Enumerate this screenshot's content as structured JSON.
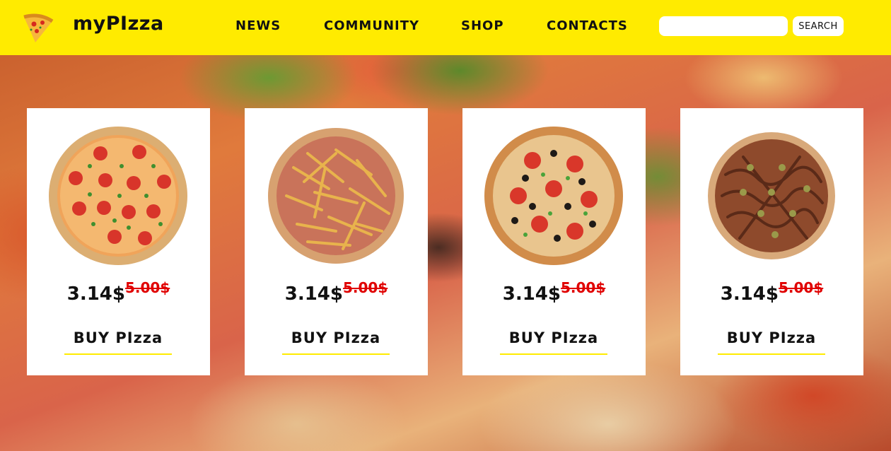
{
  "header": {
    "brand": "myPIzza",
    "nav": [
      {
        "label": "NEWS"
      },
      {
        "label": "COMMUNITY"
      },
      {
        "label": "SHOP"
      },
      {
        "label": "CONTACTS"
      }
    ],
    "search": {
      "value": "",
      "placeholder": "",
      "button_label": "SEARCH"
    }
  },
  "colors": {
    "header_bg": "#ffeb00",
    "old_price": "#e00000",
    "card_bg": "#ffffff"
  },
  "products": [
    {
      "image_icon": "margherita-pizza-icon",
      "price": "3.14$",
      "old_price": "5.00$",
      "buy_label": "BUY PIzza"
    },
    {
      "image_icon": "fries-pizza-icon",
      "price": "3.14$",
      "old_price": "5.00$",
      "buy_label": "BUY PIzza"
    },
    {
      "image_icon": "vegetable-pizza-icon",
      "price": "3.14$",
      "old_price": "5.00$",
      "buy_label": "BUY PIzza"
    },
    {
      "image_icon": "bbq-pizza-icon",
      "price": "3.14$",
      "old_price": "5.00$",
      "buy_label": "BUY PIzza"
    }
  ]
}
